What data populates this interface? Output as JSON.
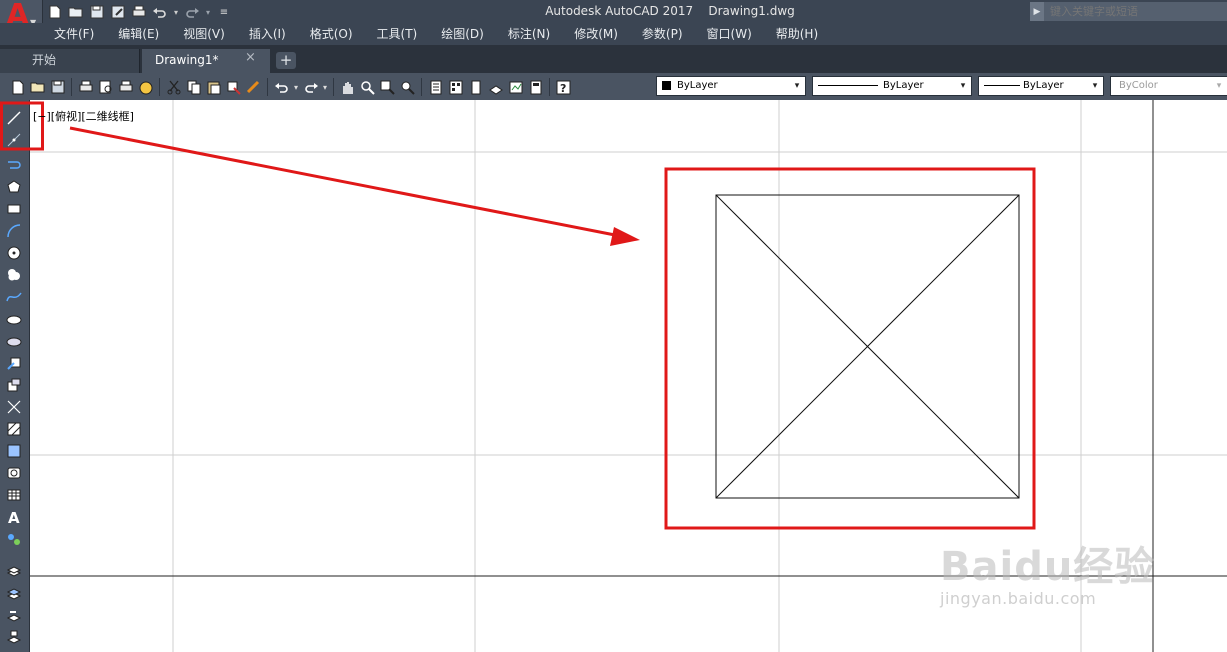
{
  "app": {
    "title": "Autodesk AutoCAD 2017    Drawing1.dwg",
    "logo_letter": "A",
    "search_placeholder": "键入关键字或短语"
  },
  "menu": [
    "文件(F)",
    "编辑(E)",
    "视图(V)",
    "插入(I)",
    "格式(O)",
    "工具(T)",
    "绘图(D)",
    "标注(N)",
    "修改(M)",
    "参数(P)",
    "窗口(W)",
    "帮助(H)"
  ],
  "tabs": {
    "start": "开始",
    "drawing": "Drawing1*",
    "close_glyph": "×",
    "add_glyph": "+"
  },
  "properties": {
    "layer": "ByLayer",
    "linetype": "ByLayer",
    "lineweight": "ByLayer",
    "color": "ByColor",
    "arrow": "▾"
  },
  "viewport": {
    "label": "[−][俯视][二维线框]"
  },
  "watermark": {
    "line1": "Baidu经验",
    "line2": "jingyan.baidu.com"
  },
  "colors": {
    "highlight": "#e01818",
    "chrome": "#4a5462",
    "titlebar": "#3b4553"
  }
}
